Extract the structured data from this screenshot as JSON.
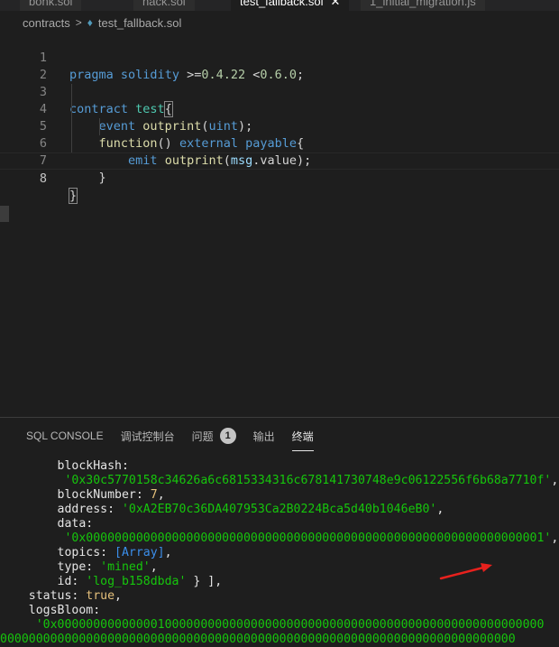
{
  "tabs": [
    {
      "label": "bonk.sol",
      "active": false
    },
    {
      "label": "hack.sol",
      "active": false
    },
    {
      "label": "test_fallback.sol",
      "active": true
    },
    {
      "label": "1_initial_migration.js",
      "active": false
    }
  ],
  "breadcrumb": {
    "folder": "contracts",
    "file": "test_fallback.sol"
  },
  "editor": {
    "current_line": 8,
    "lines": [
      {
        "n": "1",
        "text": "pragma solidity >=0.4.22 <0.6.0;"
      },
      {
        "n": "2",
        "text": ""
      },
      {
        "n": "3",
        "text": "contract test{"
      },
      {
        "n": "4",
        "text": "    event outprint(uint);"
      },
      {
        "n": "5",
        "text": "    function() external payable{"
      },
      {
        "n": "6",
        "text": "        emit outprint(msg.value);"
      },
      {
        "n": "7",
        "text": "    }"
      },
      {
        "n": "8",
        "text": "}"
      }
    ]
  },
  "panel": {
    "tabs": [
      {
        "label": "SQL CONSOLE",
        "active": false
      },
      {
        "label": "调试控制台",
        "active": false
      },
      {
        "label": "问题",
        "badge": "1",
        "active": false
      },
      {
        "label": "输出",
        "active": false
      },
      {
        "label": "终端",
        "active": true
      }
    ],
    "terminal_lines": [
      {
        "indent": "        ",
        "key": "blockHash:",
        "value": "",
        "value_type": "plain",
        "suffix": ""
      },
      {
        "indent": "         ",
        "key": "",
        "value": "'0x30c5770158c34626a6c6815334316c678141730748e9c06122556f6b68a7710f'",
        "value_type": "str",
        "suffix": ","
      },
      {
        "indent": "        ",
        "key": "blockNumber: ",
        "value": "7",
        "value_type": "num",
        "suffix": ","
      },
      {
        "indent": "        ",
        "key": "address: ",
        "value": "'0xA2EB70c36DA407953Ca2B0224Bca5d40b1046eB0'",
        "value_type": "str",
        "suffix": ","
      },
      {
        "indent": "        ",
        "key": "data:",
        "value": "",
        "value_type": "plain",
        "suffix": ""
      },
      {
        "indent": "         ",
        "key": "",
        "value": "'0x0000000000000000000000000000000000000000000000000000000000000001'",
        "value_type": "str",
        "suffix": ","
      },
      {
        "indent": "        ",
        "key": "topics: ",
        "value": "[Array]",
        "value_type": "arr",
        "suffix": ","
      },
      {
        "indent": "        ",
        "key": "type: ",
        "value": "'mined'",
        "value_type": "str",
        "suffix": ","
      },
      {
        "indent": "        ",
        "key": "id: ",
        "value": "'log_b158dbda'",
        "value_type": "str",
        "suffix": " } ],"
      },
      {
        "indent": "    ",
        "key": "status: ",
        "value": "true",
        "value_type": "bool",
        "suffix": ","
      },
      {
        "indent": "    ",
        "key": "logsBloom:",
        "value": "",
        "value_type": "plain",
        "suffix": ""
      },
      {
        "indent": "     ",
        "key": "",
        "value": "'0x00000000000000100000000000000000000000000000000000000000000000000000",
        "value_type": "str",
        "suffix": ""
      },
      {
        "indent": "",
        "key": "",
        "value": "000000000000000000000000000000000000000000000000000000000000000000000000",
        "value_type": "str",
        "suffix": ""
      }
    ]
  },
  "colors": {
    "editor_bg": "#1e1e1e",
    "keyword": "#569cd6",
    "function": "#dcdcaa",
    "type": "#4ec9b0",
    "identifier": "#9cdcfe",
    "terminal_string": "#16c60c",
    "annotation_arrow": "#e8211d"
  }
}
